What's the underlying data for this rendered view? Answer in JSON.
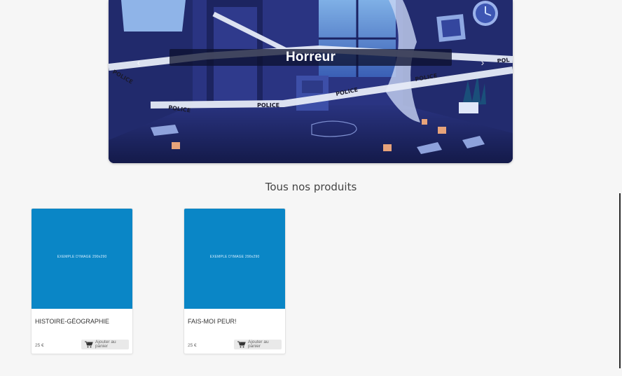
{
  "carousel": {
    "caption": "Horreur",
    "prev_label": "‹",
    "next_label": "›",
    "tape_text": "POLICE"
  },
  "section": {
    "title": "Tous nos produits"
  },
  "products": [
    {
      "image_text": "EXEMPLE D'IMAGE 290x290",
      "name": "HISTOIRE-GÉOGRAPHIE",
      "price": "25 €",
      "add_label": "Ajouter au panier"
    },
    {
      "image_text": "EXEMPLE D'IMAGE 290x290",
      "name": "FAIS-MOI PEUR!",
      "price": "25 €",
      "add_label": "Ajouter au panier"
    }
  ],
  "colors": {
    "card_image": "#0a86c6",
    "page_bg": "#f6f6f6",
    "scene": "#262f78"
  }
}
